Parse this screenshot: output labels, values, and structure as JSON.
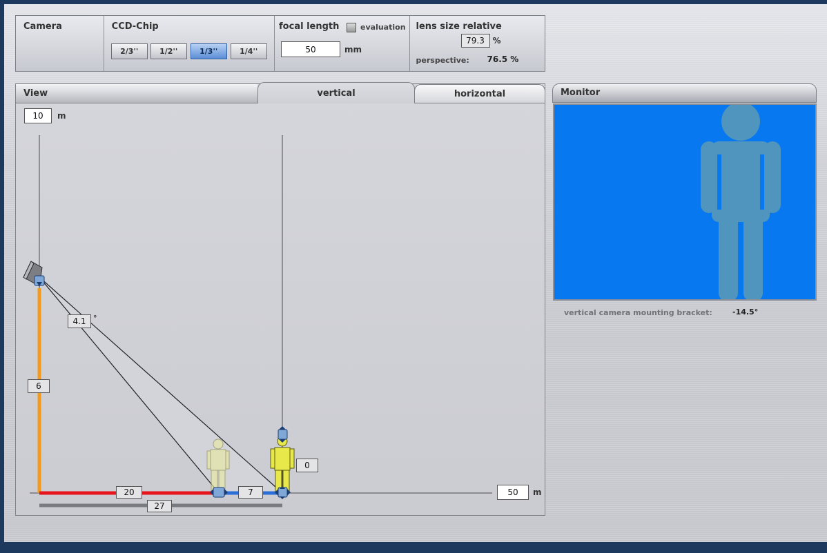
{
  "toolbar": {
    "camera_label": "Camera",
    "ccd_label": "CCD-Chip",
    "chip_options": [
      "2/3''",
      "1/2''",
      "1/3''",
      "1/4''"
    ],
    "chip_selected": "1/3''",
    "focal_label": "focal length",
    "evaluation_label": "evaluation",
    "focal_value": "50",
    "focal_unit": "mm",
    "lens_label": "lens size relative",
    "lens_value": "79.3",
    "lens_unit": "%",
    "perspective_label": "perspective:",
    "perspective_value": "76.5 %"
  },
  "view": {
    "title": "View",
    "tab_vertical": "vertical",
    "tab_horizontal": "horizontal",
    "height_scale_value": "10",
    "height_scale_unit": "m",
    "distance_scale_value": "50",
    "distance_scale_unit": "m",
    "angle_value": "4.1",
    "angle_unit": "°",
    "camera_height": "6",
    "near_distance": "20",
    "field_depth": "7",
    "total_distance": "27",
    "target_offset": "0"
  },
  "monitor": {
    "title": "Monitor",
    "bracket_label": "vertical camera mounting bracket:",
    "bracket_value": "-14.5°"
  },
  "colors": {
    "camera_height_line": "#f39a1c",
    "near_distance_line": "#e8141c",
    "field_depth_line": "#2a6ed8",
    "monitor_background": "#0778f0",
    "person_silhouette": "#4f95bd",
    "person_figure": "#e8e84a"
  }
}
